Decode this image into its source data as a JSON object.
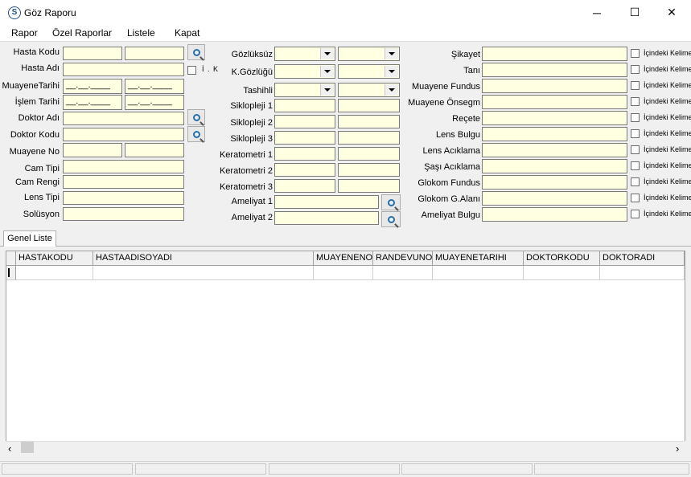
{
  "window": {
    "title": "Göz Raporu",
    "minimize": "─",
    "maximize": "☐",
    "close": "✕"
  },
  "menu": [
    "Rapor",
    "Özel Raporlar",
    "Listele",
    "Kapat"
  ],
  "left_fields": {
    "hasta_kodu": "Hasta Kodu",
    "hasta_adi": "Hasta Adı",
    "ik_label": "İ . K",
    "muayene_tarihi": "MuayeneTarihi",
    "islem_tarihi": "İşlem Tarihi",
    "doktor_adi": "Doktor Adı",
    "doktor_kodu": "Doktor Kodu",
    "muayene_no": "Muayene No",
    "cam_tipi": "Cam Tipi",
    "cam_rengi": "Cam Rengi",
    "lens_tipi": "Lens Tipi",
    "solusyon": "Solüsyon",
    "date_mask": "__.__.____"
  },
  "middle_fields": {
    "gozluksuz": "Gözlüksüz",
    "k_gozlugu": "K.Gözlüğü",
    "tashihli": "Tashihli",
    "sikl1": "Siklopleji 1",
    "sikl2": "Siklopleji 2",
    "sikl3": "Siklopleji 3",
    "kera1": "Keratometri 1",
    "kera2": "Keratometri 2",
    "kera3": "Keratometri 3",
    "amel1": "Ameliyat 1",
    "amel2": "Ameliyat 2"
  },
  "right_fields": {
    "labels": [
      "Şikayet",
      "Tanı",
      "Muayene Fundus",
      "Muayene Önsegm",
      "Reçete",
      "Lens Bulgu",
      "Lens Acıklama",
      "Şaşı Acıklama",
      "Glokom Fundus",
      "Glokom G.Alanı",
      "Ameliyat Bulgu"
    ],
    "checkbox_label": "İçindeki Kelime"
  },
  "tab": "Genel Liste",
  "grid": {
    "columns": [
      "HASTAKODU",
      "HASTAADISOYADI",
      "MUAYENENO",
      "RANDEVUNO",
      "MUAYENETARIHI",
      "DOKTORKODU",
      "DOKTORADI"
    ]
  },
  "scroll": {
    "left": "‹",
    "right": "›"
  }
}
